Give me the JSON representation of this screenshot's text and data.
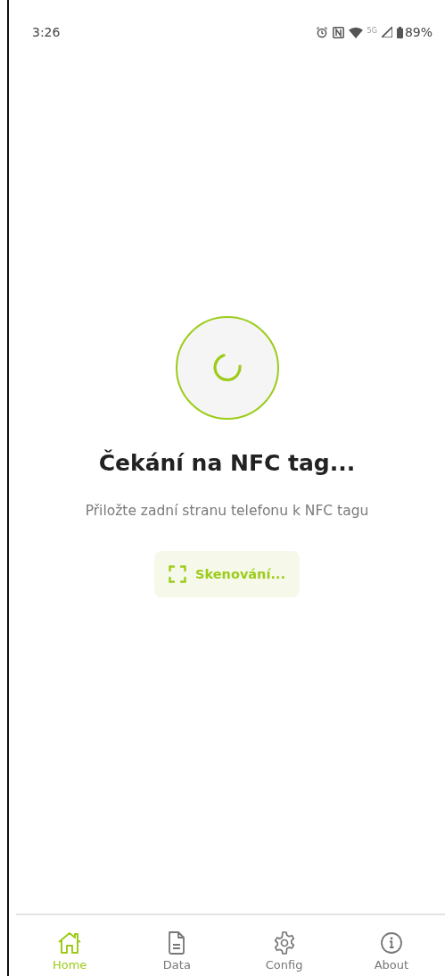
{
  "status_bar": {
    "time": "3:26",
    "network": "5G",
    "battery": "89%"
  },
  "title": "Čekání na NFC tag...",
  "hint": "Přiložte zadní stranu telefonu k NFC tagu",
  "scan_button": {
    "label": "Skenování..."
  },
  "tabs": [
    {
      "label": "Home",
      "kind": "home",
      "selected": true
    },
    {
      "label": "Data",
      "kind": "data",
      "selected": false
    },
    {
      "label": "Config",
      "kind": "config",
      "selected": false
    },
    {
      "label": "About",
      "kind": "about",
      "selected": false
    }
  ]
}
